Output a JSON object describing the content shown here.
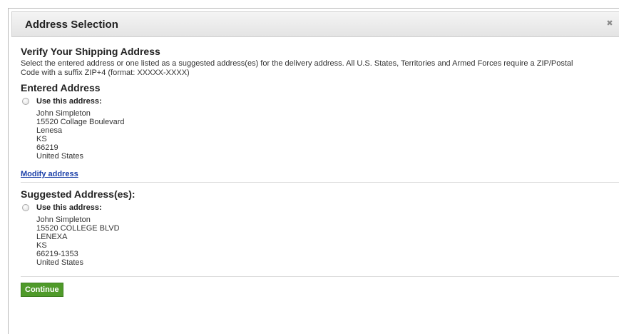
{
  "dialog": {
    "title": "Address Selection",
    "close_glyph": "✖",
    "close_icon": "close-icon"
  },
  "verify": {
    "heading": "Verify Your Shipping Address",
    "description": "Select the entered address or one listed as a suggested address(es) for the delivery address. All U.S. States, Territories and Armed Forces require a ZIP/Postal Code with a suffix ZIP+4 (format: XXXXX-XXXX)"
  },
  "entered": {
    "heading": "Entered Address",
    "radio_label": "Use this address:",
    "lines": [
      "John Simpleton",
      "15520 Collage Boulevard",
      "Lenesa",
      "KS",
      "66219",
      "United States"
    ],
    "modify_link": "Modify address"
  },
  "suggested": {
    "heading": "Suggested Address(es):",
    "radio_label": "Use this address:",
    "lines": [
      "John Simpleton",
      "15520 COLLEGE BLVD",
      "LENEXA",
      "KS",
      "66219-1353",
      "United States"
    ]
  },
  "actions": {
    "continue_label": "Continue"
  },
  "colors": {
    "accent_green": "#4f9a2a",
    "link_blue": "#1a3fa8"
  }
}
